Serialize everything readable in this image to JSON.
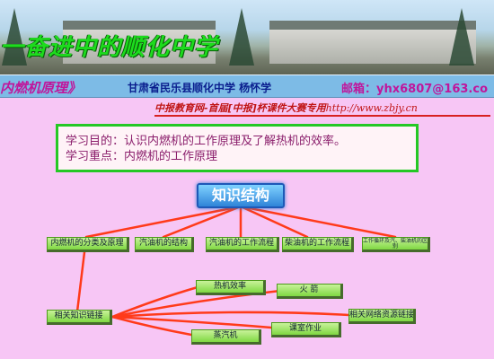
{
  "header": {
    "slogan": "一奋进中的顺化中学",
    "course_title": "内燃机原理》",
    "author": "甘肃省民乐县顺化中学 杨怀学",
    "email": "邮箱：yhx6807@163.co",
    "contest_text": "中报教育网-首届[中报]杯课件大赛专用",
    "contest_url": "http://www.zbjy.cn"
  },
  "goals": {
    "purpose": "学习目的：认识内燃机的工作原理及了解热机的效率。",
    "focus": "学习重点：内燃机的工作原理"
  },
  "structure": {
    "title": "知识结构",
    "row1": [
      "内燃机的分类及原理",
      "汽油机的结构",
      "汽油机的工作流程",
      "柴油机的工作流程",
      "工作循环及汽、柴油机的区别"
    ],
    "links_hub": "相关知识链接",
    "links": [
      "热机效率",
      "火 箭",
      "相关网络资源链接",
      "课室作业",
      "蒸汽机"
    ]
  },
  "colors": {
    "background": "#f7c6f5",
    "title_bar": "#7dbbe6",
    "goal_border": "#25c825",
    "node_fill": "#7fd842",
    "connector": "#ff3a1a",
    "contest_red": "#c01414"
  }
}
